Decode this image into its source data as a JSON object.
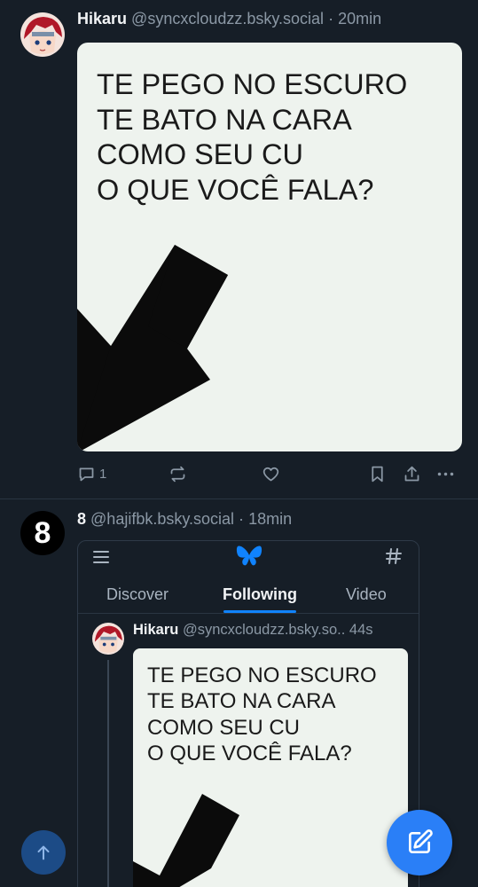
{
  "post1": {
    "author_name": "Hikaru",
    "handle": "@syncxcloudzz.bsky.social",
    "separator": "·",
    "time": "20min",
    "meme_lines": [
      "TE PEGO NO ESCURO",
      "TE BATO NA CARA",
      "COMO SEU CU",
      "O QUE VOCÊ FALA?"
    ],
    "reply_count": "1",
    "icons": [
      "reply-icon",
      "repost-icon",
      "like-icon",
      "bookmark-icon",
      "share-icon",
      "more-icon"
    ]
  },
  "post2": {
    "avatar_label": "8",
    "author_name": "8",
    "handle": "@hajifbk.bsky.social",
    "separator": "·",
    "time": "18min",
    "embed": {
      "tabs": [
        "Discover",
        "Following",
        "Video"
      ],
      "active_tab": "Following",
      "inner_post": {
        "author_name": "Hikaru",
        "handle": "@syncxcloudzz.bsky.so..",
        "time": "44s",
        "meme_lines": [
          "TE PEGO NO ESCURO",
          "TE BATO NA CARA",
          "COMO SEU CU",
          "O QUE VOCÊ FALA?"
        ]
      }
    }
  },
  "colors": {
    "background": "#161e27",
    "accent": "#1083fe",
    "compose_button": "#2a7ff7",
    "muted_text": "#8b98a5"
  }
}
